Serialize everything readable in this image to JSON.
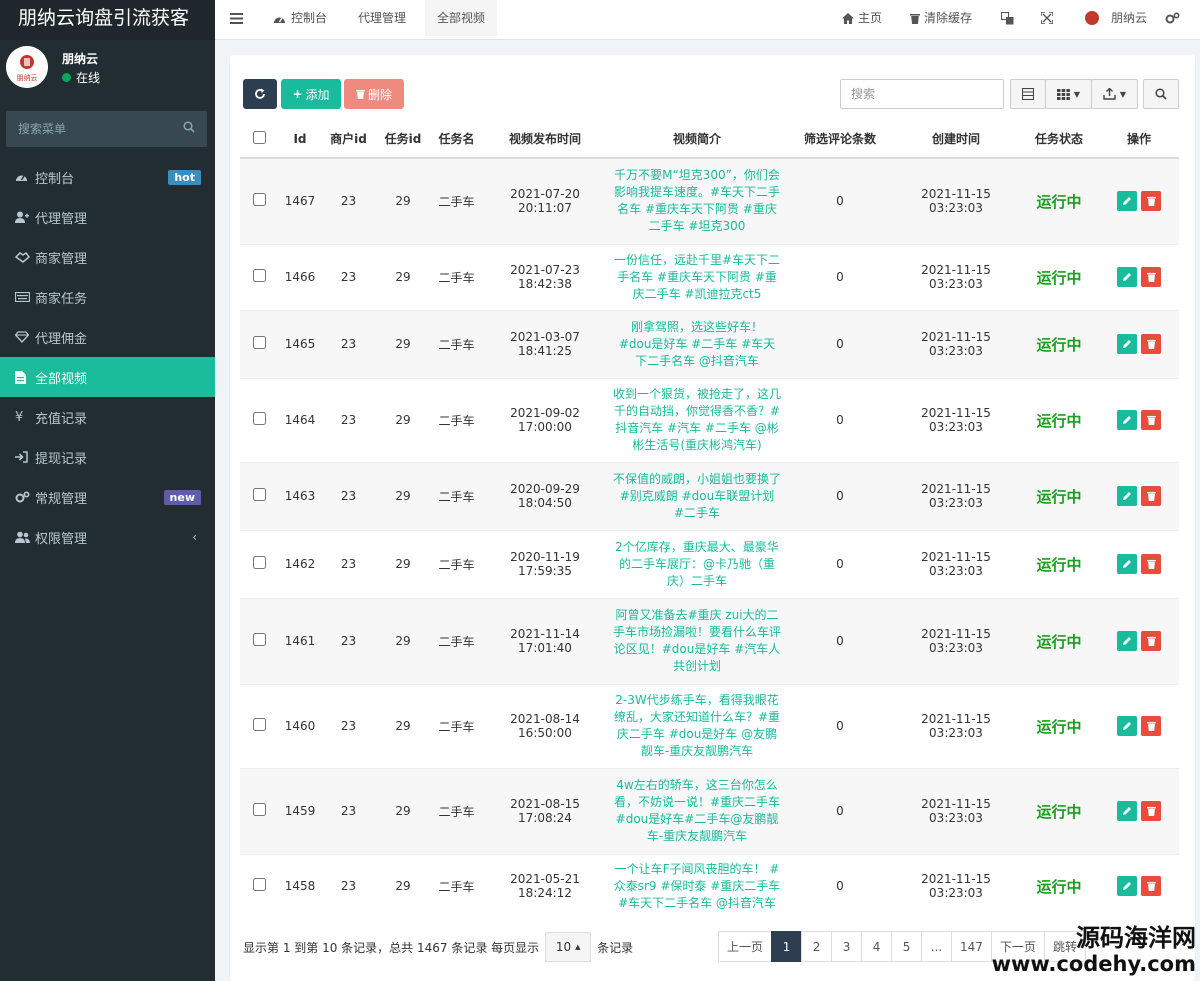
{
  "app": {
    "title": "朋纳云询盘引流获客"
  },
  "user": {
    "name": "朋纳云",
    "status": "在线",
    "avatar_text": "朋纳云"
  },
  "sidebar": {
    "search_placeholder": "搜索菜单",
    "items": [
      {
        "label": "控制台",
        "icon": "dashboard-icon",
        "badge": "hot"
      },
      {
        "label": "代理管理",
        "icon": "user-plus-icon"
      },
      {
        "label": "商家管理",
        "icon": "handshake-icon"
      },
      {
        "label": "商家任务",
        "icon": "keyboard-icon"
      },
      {
        "label": "代理佣金",
        "icon": "diamond-icon"
      },
      {
        "label": "全部视频",
        "icon": "file-icon",
        "active": true
      },
      {
        "label": "充值记录",
        "icon": "yen-icon"
      },
      {
        "label": "提现记录",
        "icon": "sign-in-icon"
      },
      {
        "label": "常规管理",
        "icon": "cogs-icon",
        "badge": "new"
      },
      {
        "label": "权限管理",
        "icon": "users-icon"
      }
    ]
  },
  "navbar": {
    "tabs": [
      {
        "label": "控制台",
        "icon": "dashboard-icon"
      },
      {
        "label": "代理管理"
      },
      {
        "label": "全部视频",
        "active": true
      }
    ],
    "right": {
      "home": "主页",
      "clear_cache": "清除缓存",
      "username": "朋纳云"
    }
  },
  "toolbar": {
    "add": "添加",
    "delete": "删除",
    "search_placeholder": "搜索"
  },
  "table": {
    "columns": [
      "Id",
      "商户id",
      "任务id",
      "任务名",
      "视频发布时间",
      "视频简介",
      "筛选评论条数",
      "创建时间",
      "任务状态",
      "操作"
    ],
    "rows": [
      {
        "id": "1467",
        "merchant_id": "23",
        "task_id": "29",
        "task_name": "二手车",
        "publish_time": "2021-07-20 20:11:07",
        "desc": "千万不要M“坦克300”，你们会影响我提车速度。#车天下二手名车 #重庆车天下阿贵 #重庆二手车 #坦克300",
        "comments": "0",
        "created": "2021-11-15 03:23:03",
        "status": "运行中"
      },
      {
        "id": "1466",
        "merchant_id": "23",
        "task_id": "29",
        "task_name": "二手车",
        "publish_time": "2021-07-23 18:42:38",
        "desc": "一份信任，远赴千里#车天下二手名车 #重庆车天下阿贵 #重庆二手车 #凯迪拉克ct5",
        "comments": "0",
        "created": "2021-11-15 03:23:03",
        "status": "运行中"
      },
      {
        "id": "1465",
        "merchant_id": "23",
        "task_id": "29",
        "task_name": "二手车",
        "publish_time": "2021-03-07 18:41:25",
        "desc": "刚拿驾照，选这些好车！ #dou是好车 #二手车 #车天下二手名车 @抖音汽车",
        "comments": "0",
        "created": "2021-11-15 03:23:03",
        "status": "运行中"
      },
      {
        "id": "1464",
        "merchant_id": "23",
        "task_id": "29",
        "task_name": "二手车",
        "publish_time": "2021-09-02 17:00:00",
        "desc": "收到一个狠货，被抢走了，这几千的自动挡，你觉得香不香？#抖音汽车 #汽车 #二手车 @彬彬生活号(重庆彬鸿汽车)",
        "comments": "0",
        "created": "2021-11-15 03:23:03",
        "status": "运行中"
      },
      {
        "id": "1463",
        "merchant_id": "23",
        "task_id": "29",
        "task_name": "二手车",
        "publish_time": "2020-09-29 18:04:50",
        "desc": "不保值的威朗，小姐姐也要换了#别克威朗 #dou车联盟计划 #二手车",
        "comments": "0",
        "created": "2021-11-15 03:23:03",
        "status": "运行中"
      },
      {
        "id": "1462",
        "merchant_id": "23",
        "task_id": "29",
        "task_name": "二手车",
        "publish_time": "2020-11-19 17:59:35",
        "desc": "2个亿库存，重庆最大、最豪华的二手车展厅：@卡乃驰（重庆）二手车",
        "comments": "0",
        "created": "2021-11-15 03:23:03",
        "status": "运行中"
      },
      {
        "id": "1461",
        "merchant_id": "23",
        "task_id": "29",
        "task_name": "二手车",
        "publish_time": "2021-11-14 17:01:40",
        "desc": "阿曾又准备去#重庆 zui大的二手车市场捡漏啦！要看什么车评论区见！#dou是好车 #汽车人共创计划",
        "comments": "0",
        "created": "2021-11-15 03:23:03",
        "status": "运行中"
      },
      {
        "id": "1460",
        "merchant_id": "23",
        "task_id": "29",
        "task_name": "二手车",
        "publish_time": "2021-08-14 16:50:00",
        "desc": "2-3W代步练手车，看得我眼花缭乱，大家还知道什么车？#重庆二手车 #dou是好车 @友鹏靓车-重庆友靓鹏汽车",
        "comments": "0",
        "created": "2021-11-15 03:23:03",
        "status": "运行中"
      },
      {
        "id": "1459",
        "merchant_id": "23",
        "task_id": "29",
        "task_name": "二手车",
        "publish_time": "2021-08-15 17:08:24",
        "desc": "4w左右的轿车，这三台你怎么看，不妨说一说！#重庆二手车 #dou是好车#二手车@友鹏靓车-重庆友靓鹏汽车",
        "comments": "0",
        "created": "2021-11-15 03:23:03",
        "status": "运行中"
      },
      {
        "id": "1458",
        "merchant_id": "23",
        "task_id": "29",
        "task_name": "二手车",
        "publish_time": "2021-05-21 18:24:12",
        "desc": "一个让车F子闻风丧胆的车！ #众泰sr9 #保时泰 #重庆二手车 #车天下二手名车 @抖音汽车",
        "comments": "0",
        "created": "2021-11-15 03:23:03",
        "status": "运行中"
      }
    ]
  },
  "pagination": {
    "info_prefix": "显示第 1 到第 10 条记录，总共 1467 条记录 每页显示",
    "page_size": "10",
    "info_suffix": "条记录",
    "prev": "上一页",
    "pages": [
      "1",
      "2",
      "3",
      "4",
      "5",
      "...",
      "147"
    ],
    "next": "下一页",
    "jump": "跳转",
    "active_page": "1"
  },
  "watermark": {
    "line1": "源码海洋网",
    "line2": "www.codehy.com"
  },
  "colors": {
    "sidebar_bg": "#222d32",
    "active_menu": "#1abc9c",
    "accent_green": "#18bc9c",
    "danger": "#e74c3c",
    "dark": "#2c3e50",
    "status_green": "#18a01d"
  }
}
